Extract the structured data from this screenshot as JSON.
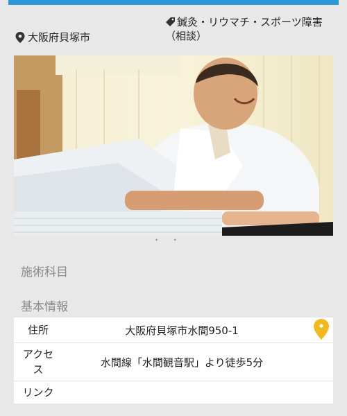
{
  "header": {
    "location": "大阪府貝塚市",
    "tag": "鍼灸・リウマチ・スポーツ障害（相談）"
  },
  "photo": {
    "alt": "白衣の施術者が患者の手を施術している写真"
  },
  "carousel": {
    "dots": "••"
  },
  "sections": {
    "treatments_title": "施術科目",
    "basic_info_title": "基本情報"
  },
  "info": {
    "address_label": "住所",
    "address_value": "大阪府貝塚市水間950-1",
    "access_label": "アクセス",
    "access_value": "水間線「水間観音駅」より徒歩5分",
    "link_label": "リンク",
    "link_value": ""
  },
  "colors": {
    "accent": "#2a9ad6",
    "map_pin": "#f2b822"
  },
  "icons": {
    "location": "map-pin-icon",
    "tag": "tag-icon",
    "map": "map-marker-icon"
  }
}
